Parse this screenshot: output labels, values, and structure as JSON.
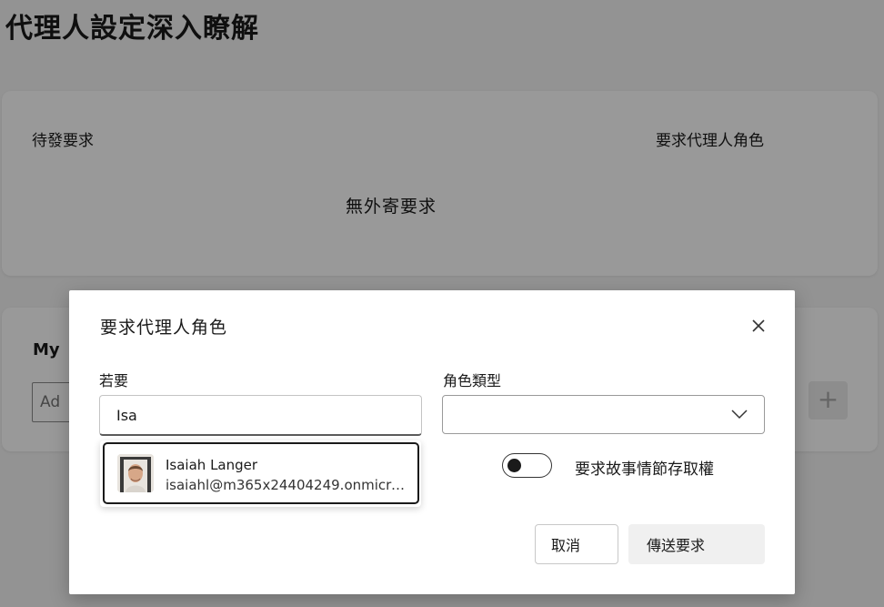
{
  "page": {
    "title": "代理人設定深入瞭解",
    "pending": {
      "label": "待發要求",
      "request_role_link": "要求代理人角色",
      "empty_text": "無外寄要求"
    },
    "my_section": {
      "title": "My",
      "add_placeholder": "Ad"
    }
  },
  "dialog": {
    "title": "要求代理人角色",
    "name_label": "若要",
    "name_value": "Isa",
    "role_label": "角色類型",
    "role_value": "",
    "suggestion": {
      "name": "Isaiah Langer",
      "email": "isaiahl@m365x24404249.onmicro..."
    },
    "toggle": {
      "label": "要求故事情節存取權",
      "on": false
    },
    "cancel_label": "取消",
    "send_label": "傳送要求"
  },
  "icons": {
    "close": "close-icon",
    "chevron": "chevron-down-icon",
    "plus": "plus-icon"
  },
  "colors": {
    "overlay": "#666666",
    "dialog_bg": "#ffffff",
    "toggle_knob": "#1a1a1a"
  }
}
